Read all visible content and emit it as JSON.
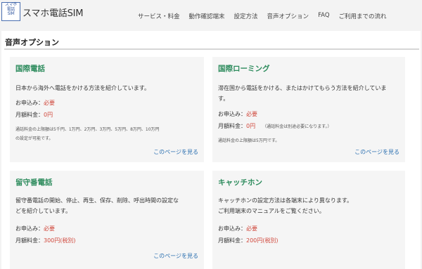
{
  "header": {
    "logo_lines": [
      "スマホ",
      "電話",
      "SIM"
    ],
    "site_title": "スマホ電話SIM",
    "nav": [
      "サービス・料金",
      "動作確認端末",
      "設定方法",
      "音声オプション",
      "FAQ",
      "ご利用までの流れ"
    ]
  },
  "section_title": "音声オプション",
  "cards": [
    {
      "title": "国際電話",
      "desc": [
        "日本から海外へ電話をかける方法を紹介しています。"
      ],
      "apply_label": "お申込み：",
      "apply_value": "必要",
      "fee_label": "月額料金：",
      "fee_value": "0円",
      "fee_note": "",
      "extra": [
        "通話料金の上限額は5千円、1万円、2万円、3万円、5万円、8万円、10万円",
        "の設定が可能です。"
      ],
      "more": "このページを見る"
    },
    {
      "title": "国際ローミング",
      "desc": [
        "滞在国から電話をかける、またはかけてもらう方法を紹介していま",
        "す。"
      ],
      "apply_label": "お申込み：",
      "apply_value": "必要",
      "fee_label": "月額料金：",
      "fee_value": "0円",
      "fee_note": "（通話料金は別途必要になります。）",
      "extra": [
        "通話料金の上限額は5万円です。"
      ],
      "more": "このページを見る"
    },
    {
      "title": "留守番電話",
      "desc": [
        "留守番電話の開始、停止、再生、保存、削除、呼出時間の設定な",
        "どを紹介しています。"
      ],
      "apply_label": "お申込み：",
      "apply_value": "必要",
      "fee_label": "月額料金：",
      "fee_value": "300円(税別)",
      "fee_note": "",
      "extra": [],
      "more": "このページを見る"
    },
    {
      "title": "キャッチホン",
      "desc": [
        "キャッチホンの設定方法は各端末により異なります。",
        "ご利用端末のマニュアルをご覧ください。"
      ],
      "apply_label": "お申込み：",
      "apply_value": "必要",
      "fee_label": "月額料金：",
      "fee_value": "200円(税別)",
      "fee_note": "",
      "extra": [],
      "more": ""
    }
  ],
  "colors": {
    "title_green": "#2c8b5c",
    "value_red": "#d0473b",
    "link_blue": "#2a6fb0"
  }
}
